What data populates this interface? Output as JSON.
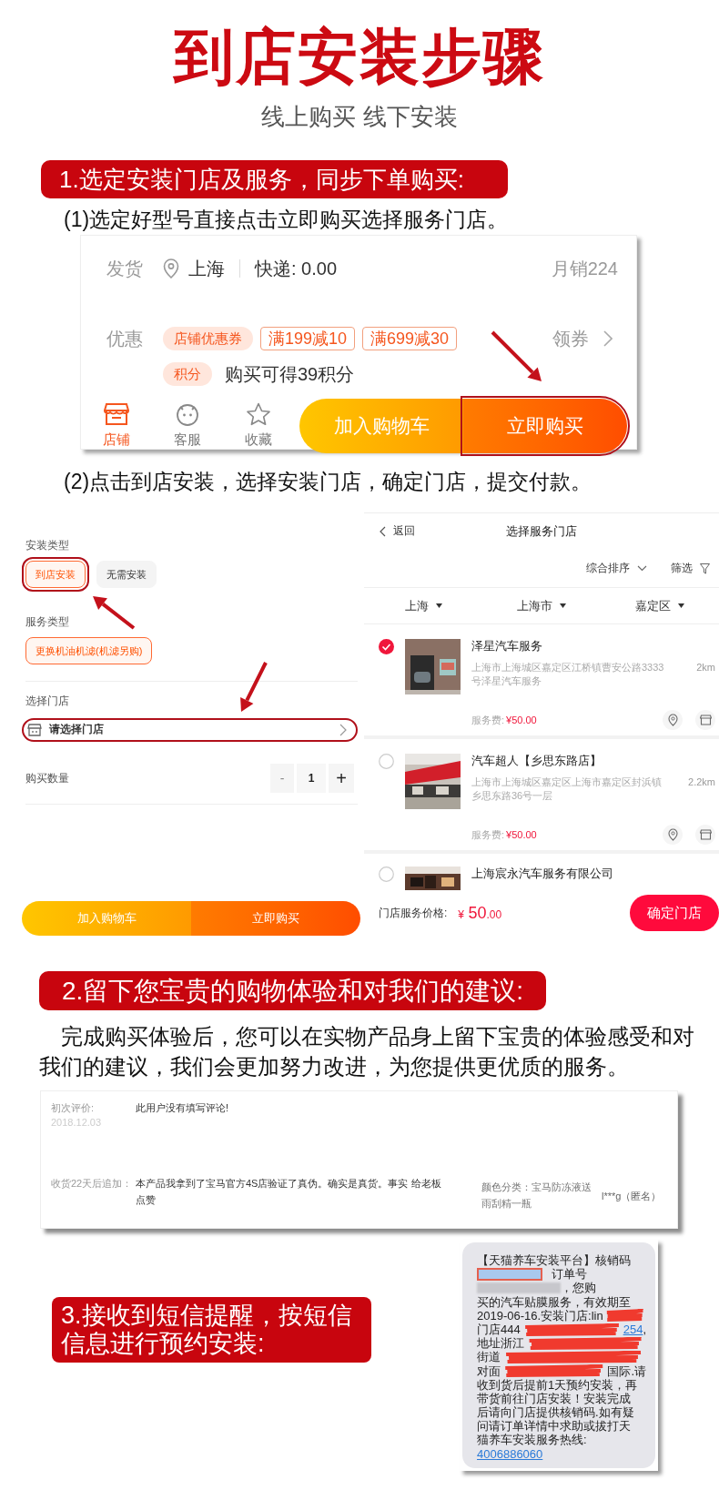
{
  "header": {
    "title": "到店安装步骤",
    "subtitle": "线上购买 线下安装"
  },
  "step1": {
    "banner": "1.选定安装门店及服务，同步下单购买:",
    "instruction_1": "(1)选定好型号直接点击立即购买选择服务门店。",
    "product_card": {
      "shipping_label": "发货",
      "location": "上海",
      "express": "快递: 0.00",
      "monthly_sales": "月销224",
      "promo_label": "优惠",
      "promo_tags": [
        {
          "text": "店铺优惠券",
          "kind": "shop"
        },
        {
          "text": "满199减10",
          "kind": "coupon"
        },
        {
          "text": "满699减30",
          "kind": "coupon"
        }
      ],
      "coupon_action": "领券",
      "points_tag": "积分",
      "points_text": "购买可得39积分",
      "nav": [
        {
          "label": "店铺",
          "kind": "shop",
          "selected": true
        },
        {
          "label": "客服",
          "kind": "chat",
          "selected": false
        },
        {
          "label": "收藏",
          "kind": "star",
          "selected": false
        }
      ],
      "buttons": [
        {
          "label": "加入购物车",
          "kind": "cart",
          "highlighted": false
        },
        {
          "label": "立即购买",
          "kind": "buy",
          "highlighted": true
        }
      ]
    },
    "instruction_2": "(2)点击到店安装，选择安装门店，确定门店，提交付款。",
    "order_panel": {
      "install_label": "安装类型",
      "install_options": [
        {
          "label": "到店安装",
          "selected": true,
          "highlighted": true
        },
        {
          "label": "无需安装",
          "selected": false,
          "highlighted": false
        }
      ],
      "service_label": "服务类型",
      "service_options": [
        {
          "label": "更换机油机滤(机滤另购)",
          "selected": true
        }
      ],
      "store_label": "选择门店",
      "store_value": "请选择门店",
      "store_highlighted": true,
      "quantity_label": "购买数量",
      "decrement": "-",
      "quantity": "1",
      "increment": "+",
      "decrement_disabled": true,
      "buttons": [
        {
          "label": "加入购物车",
          "kind": "cart"
        },
        {
          "label": "立即购买",
          "kind": "buy"
        }
      ]
    },
    "store_panel": {
      "back": "返回",
      "title": "选择服务门店",
      "sort": "综合排序",
      "filter": "筛选",
      "regions": [
        "上海",
        "上海市",
        "嘉定区"
      ],
      "stores": [
        {
          "name": "泽星汽车服务",
          "address": "上海市上海城区嘉定区江桥镇曹安公路3333号泽星汽车服务",
          "distance": "2km",
          "fee_label": "服务费:",
          "fee": "¥50.00",
          "selected": true
        },
        {
          "name": "汽车超人【乡思东路店】",
          "address": "上海市上海城区嘉定区上海市嘉定区封浜镇乡思东路36号一层",
          "distance": "2.2km",
          "fee_label": "服务费:",
          "fee": "¥50.00",
          "selected": false
        },
        {
          "name": "上海宸永汽车服务有限公司",
          "selected": false
        }
      ],
      "price_label": "门店服务价格:",
      "price_currency": "¥",
      "price_whole": "50",
      "price_decimal": ".00",
      "confirm": "确定门店"
    }
  },
  "step2": {
    "banner": "2.留下您宝贵的购物体验和对我们的建议:",
    "paragraph": "完成购买体验后，您可以在实物产品身上留下宝贵的体验感受和对我们的建议，我们会更加努力改进，为您提供更优质的服务。",
    "review": {
      "first_label": "初次评价:",
      "first_date": "2018.12.03",
      "first_text": "此用户没有填写评论!",
      "followup_label": "收货22天后追加：",
      "followup_text": "本产品我拿到了宝马官方4S店验证了真伪。确实是真货。事实 给老板点赞",
      "sku": "颜色分类：宝马防冻液送雨刮精一瓶",
      "user": "l***g（匿名）"
    }
  },
  "step3": {
    "banner": "3.接收到短信提醒，按短信信息进行预约安装:",
    "sms": [
      [
        {
          "kind": "text",
          "text": "【天猫养车安装平台】核销码"
        }
      ],
      [
        {
          "kind": "code"
        },
        {
          "kind": "text",
          "text": "订单号"
        }
      ],
      [
        {
          "kind": "blurred"
        },
        {
          "kind": "text",
          "text": "，您购"
        }
      ],
      [
        {
          "kind": "text",
          "text": "买的汽车贴膜服务，有效期至"
        }
      ],
      [
        {
          "kind": "text",
          "text": "2019-06-16.安装门店:lin"
        },
        {
          "kind": "redacted"
        }
      ],
      [
        {
          "kind": "text",
          "text": "门店444"
        },
        {
          "kind": "redacted"
        },
        {
          "kind": "link",
          "text": "254"
        },
        {
          "kind": "text",
          "text": ","
        }
      ],
      [
        {
          "kind": "text",
          "text": "地址浙江"
        },
        {
          "kind": "redacted"
        }
      ],
      [
        {
          "kind": "text",
          "text": "街道"
        },
        {
          "kind": "redacted"
        }
      ],
      [
        {
          "kind": "text",
          "text": "对面"
        },
        {
          "kind": "redacted"
        },
        {
          "kind": "text",
          "text": "国际.请"
        }
      ],
      [
        {
          "kind": "text",
          "text": "收到货后提前1天预约安装，再"
        }
      ],
      [
        {
          "kind": "text",
          "text": "带货前往门店安装！安装完成"
        }
      ],
      [
        {
          "kind": "text",
          "text": "后请向门店提供核销码.如有疑"
        }
      ],
      [
        {
          "kind": "text",
          "text": "问请订单详情中求助或拔打天"
        }
      ],
      [
        {
          "kind": "text",
          "text": "猫养车安装服务热线:"
        }
      ],
      [
        {
          "kind": "link",
          "text": "4006886060"
        }
      ]
    ]
  }
}
